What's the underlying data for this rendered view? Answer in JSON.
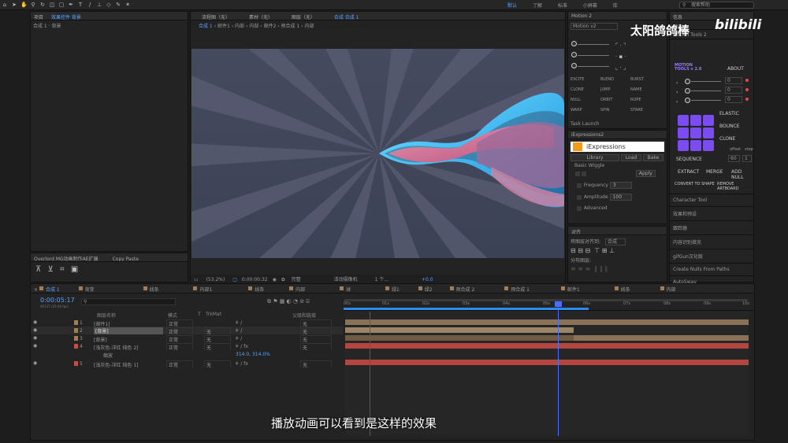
{
  "toolbar": {
    "workspaces": [
      "默认",
      "了解",
      "标准",
      "小屏幕",
      "库"
    ],
    "search_placeholder": "搜索帮助"
  },
  "project_panel": {
    "tabs": [
      "项目",
      "效果控件 背景"
    ],
    "breadcrumb": "合成 1 · 背景"
  },
  "viewer": {
    "tabs": [
      "流程图（无）",
      "素材（无）",
      "图层（无）",
      "合成 合成 1"
    ],
    "crumbs": [
      "合成 1",
      "邮件1",
      "内部",
      "内部",
      "邮件2",
      "预合成 1",
      "内部"
    ],
    "zoom": "(53.2%)",
    "timecode": "0:00:00:32",
    "quality": "完整",
    "camera": "活动摄像机",
    "views": "1 个...",
    "exposure": "+0.0"
  },
  "motion2": {
    "title": "Motion 2",
    "dropdown": "Motion v2",
    "buttons": [
      "EXCITE",
      "BLEND",
      "BURST",
      "CLONE",
      "JUMP",
      "NAME",
      "NULL",
      "ORBIT",
      "ROPE",
      "WARP",
      "SPIN",
      "STARE"
    ],
    "task_launch": "Task Launch"
  },
  "iexp": {
    "title": "iExpressions2",
    "logo": "iExpressions",
    "buttons": [
      "Library",
      "Load",
      "Bake"
    ],
    "preset": "Basic Wiggle",
    "apply": "Apply",
    "frequency_label": "Frequency",
    "frequency": "3",
    "amplitude_label": "Amplitude",
    "amplitude": "100",
    "advanced": "Advanced"
  },
  "align": {
    "title": "对齐",
    "align_to_label": "将图层对齐到:",
    "align_to": "合成",
    "distribute": "分布图层:"
  },
  "info": {
    "title": "信息",
    "preview": "预览",
    "motiontools_tab": "Motion Tools 2",
    "logo_line1": "MOTION",
    "logo_line2": "TOOLS v 2.0",
    "about": "ABOUT",
    "elastic": "ELASTIC",
    "bounce": "BOUNCE",
    "clone": "CLONE",
    "sequence": "SEQUENCE",
    "offset_label": "offset",
    "step_label": "step",
    "offset": "60",
    "step": "1",
    "extract": "EXTRACT",
    "merge": "MERGE",
    "add_null": "ADD NULL",
    "convert": "CONVERT TO SHAPE",
    "remove_artboard": "REMOVE ARTBOARD",
    "values": [
      "0",
      "0",
      "0"
    ],
    "list": [
      "Character Tool",
      "效果和预设",
      "跟踪器",
      "内容识别填充",
      "gifGun汉化版",
      "Create Nulls From Paths",
      "AutoSway"
    ]
  },
  "overlord": {
    "tab1": "Overlord MG动画制作AE扩展",
    "tab2": "Copy Paste"
  },
  "timeline": {
    "comp_tabs": [
      "合成 1",
      "渐变",
      "线条",
      "内部1",
      "线条",
      "内部",
      "球",
      "绿1",
      "绿2",
      "预合成 2",
      "预合成 1",
      "邮件1",
      "线条",
      "内部"
    ],
    "timecode": "0:00:05:17",
    "subframe": "00137 (25.00 fps)",
    "headers": {
      "name": "图层名称",
      "mode": "模式",
      "t": "T",
      "trkmat": "TrkMat",
      "parent": "父级和链接"
    },
    "ticks": [
      "00s",
      "01s",
      "02s",
      "03s",
      "04s",
      "05s",
      "06s",
      "07s",
      "08s",
      "09s",
      "10s"
    ],
    "layers": [
      {
        "num": "1",
        "name": "[邮件1]",
        "mode": "正常",
        "trk": "",
        "parent": "无",
        "color": "#a07e58"
      },
      {
        "num": "2",
        "name": "[背景]",
        "mode": "正常",
        "trk": "无",
        "parent": "无",
        "color": "#a07e58"
      },
      {
        "num": "3",
        "name": "[背景]",
        "mode": "正常",
        "trk": "无",
        "parent": "无",
        "color": "#a07e58"
      },
      {
        "num": "4",
        "name": "[浅灰色-洋红 纯色 2]",
        "mode": "正常",
        "trk": "无",
        "parent": "无",
        "color": "#c0504d"
      },
      {
        "num": "5",
        "name": "[浅灰色-洋红 纯色 1]",
        "mode": "正常",
        "trk": "无",
        "parent": "无",
        "color": "#c0504d"
      }
    ],
    "sub_label": "缩放",
    "sub_value": "314.0, 314.0%"
  },
  "subtitle": "播放动画可以看到是这样的效果",
  "watermark": {
    "name": "太阳鸽鸽棒",
    "brand": "bilibili"
  },
  "colors": {
    "accent": "#2d8ceb",
    "playhead": "#4d6dff",
    "tan": "#a07e58",
    "red": "#b5453f",
    "purple": "#7b4cf0"
  }
}
